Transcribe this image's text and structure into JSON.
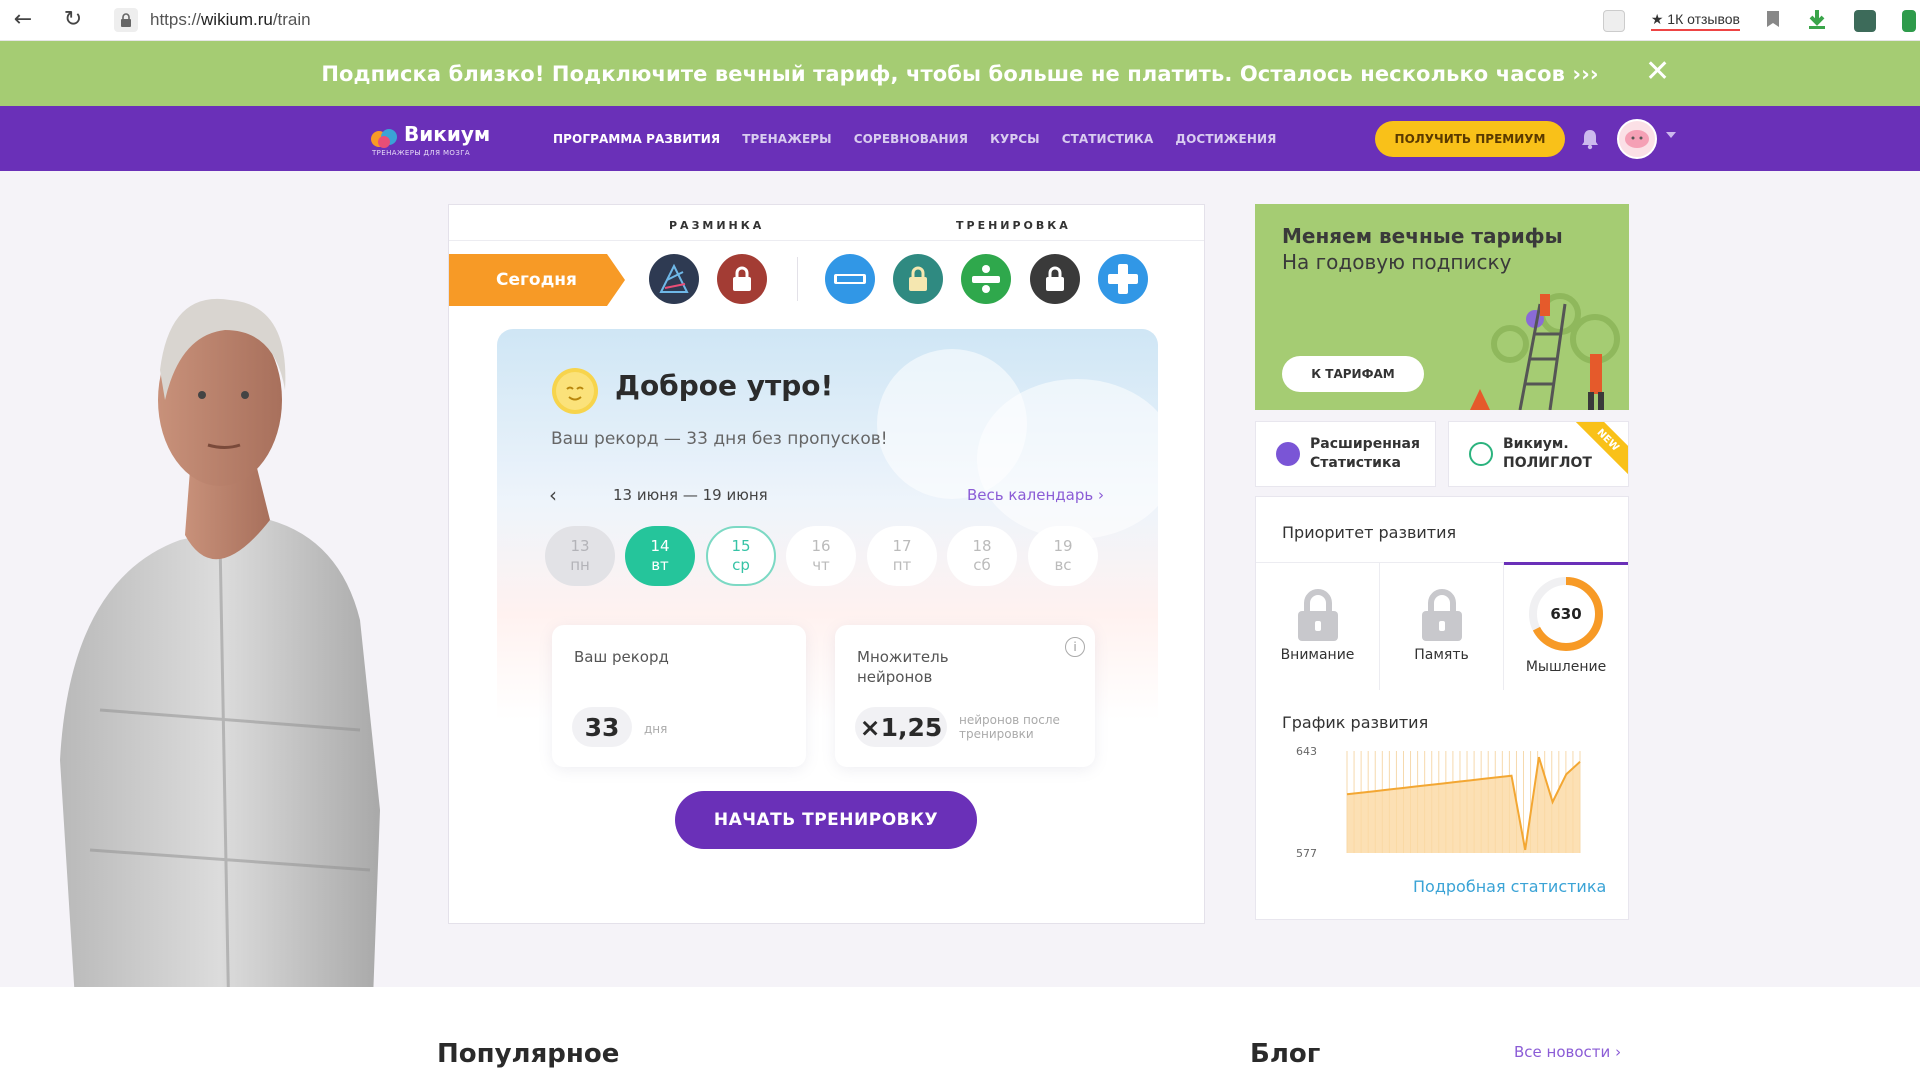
{
  "browser": {
    "url_prefix": "https://",
    "url_host": "wikium.ru",
    "url_path": "/train",
    "reviews_label": "★ 1К отзывов"
  },
  "promo": {
    "text": "Подписка близко! Подключите вечный тариф, чтобы больше не платить. Осталось несколько часов ›››"
  },
  "header": {
    "logo_name": "Викиум",
    "logo_sub": "ТРЕНАЖЕРЫ ДЛЯ МОЗГА",
    "nav": [
      {
        "label": "ПРОГРАММА РАЗВИТИЯ"
      },
      {
        "label": "ТРЕНАЖЕРЫ"
      },
      {
        "label": "СОРЕВНОВАНИЯ"
      },
      {
        "label": "КУРСЫ"
      },
      {
        "label": "СТАТИСТИКА"
      },
      {
        "label": "ДОСТИЖЕНИЯ"
      }
    ],
    "premium_label": "ПОЛУЧИТЬ ПРЕМИУМ"
  },
  "training": {
    "tab_warmup": "РАЗМИНКА",
    "tab_training": "ТРЕНИРОВКА",
    "today_label": "Сегодня",
    "greeting": "Доброе утро!",
    "record_text": "Ваш рекорд — 33 дня без пропусков!",
    "week_range": "13 июня — 19 июня",
    "calendar_link": "Весь календарь",
    "days": [
      {
        "num": "13",
        "dow": "пн"
      },
      {
        "num": "14",
        "dow": "вт"
      },
      {
        "num": "15",
        "dow": "ср"
      },
      {
        "num": "16",
        "dow": "чт"
      },
      {
        "num": "17",
        "dow": "пт"
      },
      {
        "num": "18",
        "dow": "сб"
      },
      {
        "num": "19",
        "dow": "вс"
      }
    ],
    "record_card": {
      "label": "Ваш рекорд",
      "value": "33",
      "unit": "дня"
    },
    "multiplier_card": {
      "label": "Множитель нейронов",
      "value": "×1,25",
      "unit": "нейронов после тренировки"
    },
    "start_button": "НАЧАТЬ ТРЕНИРОВКУ"
  },
  "tariff": {
    "line1": "Меняем вечные тарифы",
    "line2": "На годовую подписку",
    "button": "К ТАРИФАМ"
  },
  "features": {
    "stats_label": "Расширенная Статистика",
    "polyglot_label": "Викиум. ПОЛИГЛОТ",
    "new_badge": "NEW"
  },
  "priority": {
    "title": "Приоритет развития",
    "attention": "Внимание",
    "memory": "Память",
    "thinking": "Мышление",
    "thinking_value": "630",
    "chart_title": "График развития",
    "stats_link": "Подробная статистика"
  },
  "chart_data": {
    "type": "area",
    "title": "График развития",
    "ylim": [
      577,
      643
    ],
    "ytick_labels": [
      "643",
      "577"
    ],
    "values": [
      615,
      616,
      617,
      618,
      619,
      620,
      621,
      622,
      623,
      624,
      625,
      626,
      627,
      579,
      639,
      610,
      628,
      636
    ],
    "color": "#f3a733"
  },
  "bottom": {
    "popular": "Популярное",
    "blog": "Блог",
    "all_news": "Все новости"
  },
  "colors": {
    "promo_bg": "#a5cc73",
    "header_bg": "#6a30b8",
    "accent_yellow": "#f9c119",
    "today_orange": "#f79a26",
    "teal": "#25c59b"
  }
}
